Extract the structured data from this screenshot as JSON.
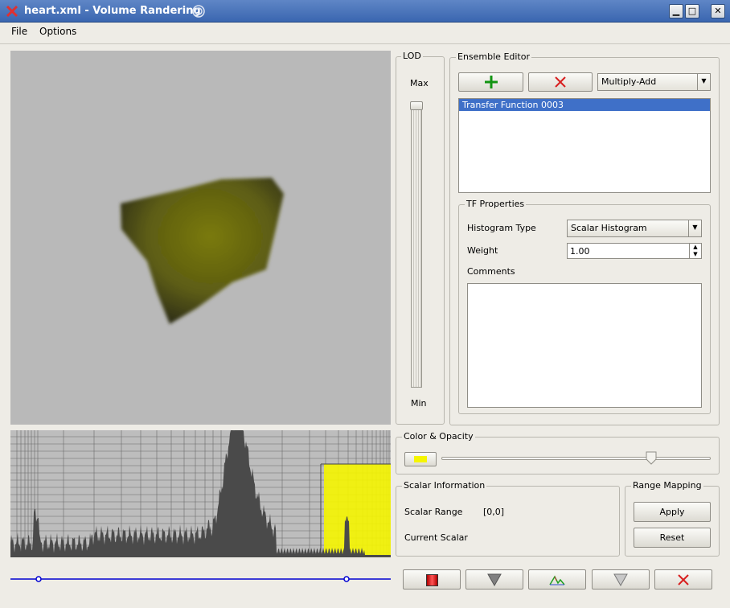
{
  "window": {
    "title": "heart.xml - Volume Randering",
    "minimize_label": "▁",
    "maximize_label": "□",
    "close_label": "✕"
  },
  "menu": {
    "file": "File",
    "options": "Options"
  },
  "lod": {
    "title": "LOD",
    "max_label": "Max",
    "min_label": "Min",
    "level": 1.0
  },
  "ensemble": {
    "title": "Ensemble Editor",
    "mode": "Multiply-Add",
    "items": [
      "Transfer Function 0003"
    ]
  },
  "tf_properties": {
    "title": "TF Properties",
    "histogram_type_label": "Histogram Type",
    "histogram_type_value": "Scalar Histogram",
    "weight_label": "Weight",
    "weight_value": "1.00",
    "comments_label": "Comments",
    "comments_value": ""
  },
  "color_opacity": {
    "title": "Color & Opacity",
    "swatch_color": "#f5f500",
    "opacity": 0.78
  },
  "scalar_info": {
    "title": "Scalar Information",
    "range_label": "Scalar Range",
    "range_value": "[0,0]",
    "current_label": "Current Scalar",
    "current_value": ""
  },
  "range_mapping": {
    "title": "Range Mapping",
    "apply": "Apply",
    "reset": "Reset"
  },
  "colors": {
    "highlight": "#3f70c8",
    "tf_line": "#0000d0",
    "volume": "#6a6a10",
    "histogram": "#4a4a4a",
    "tf_fill": "#f5f500"
  }
}
